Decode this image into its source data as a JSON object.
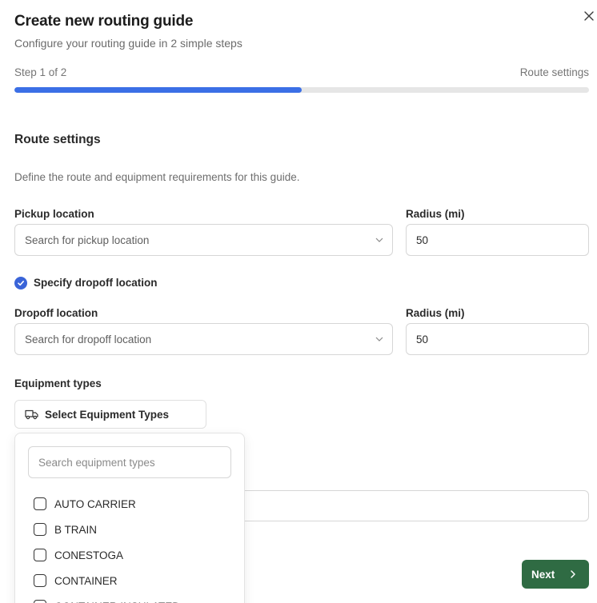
{
  "header": {
    "title": "Create new routing guide",
    "subtitle": "Configure your routing guide in 2 simple steps"
  },
  "progress": {
    "step_label": "Step 1 of 2",
    "step_name": "Route settings",
    "fraction": 0.5
  },
  "section": {
    "title": "Route settings",
    "description": "Define the route and equipment requirements for this guide."
  },
  "pickup": {
    "label": "Pickup location",
    "placeholder": "Search for pickup location",
    "radius_label": "Radius (mi)",
    "radius_value": "50"
  },
  "dropoff_toggle": {
    "label": "Specify dropoff location",
    "checked": true
  },
  "dropoff": {
    "label": "Dropoff location",
    "placeholder": "Search for dropoff location",
    "radius_label": "Radius (mi)",
    "radius_value": "50"
  },
  "equipment": {
    "label": "Equipment types",
    "button_label": "Select Equipment Types",
    "search_placeholder": "Search equipment types",
    "options": [
      "AUTO CARRIER",
      "B TRAIN",
      "CONESTOGA",
      "CONTAINER",
      "CONTAINER INSULATED"
    ]
  },
  "footer": {
    "next_label": "Next"
  },
  "colors": {
    "progress": "#3b6fe6",
    "checkbox": "#3a64d8",
    "primary_button": "#2f6b43"
  },
  "icons": {
    "close": "close-icon",
    "chevron": "chevron-down-icon",
    "truck": "truck-icon",
    "check": "check-icon",
    "next": "chevron-right-icon"
  }
}
